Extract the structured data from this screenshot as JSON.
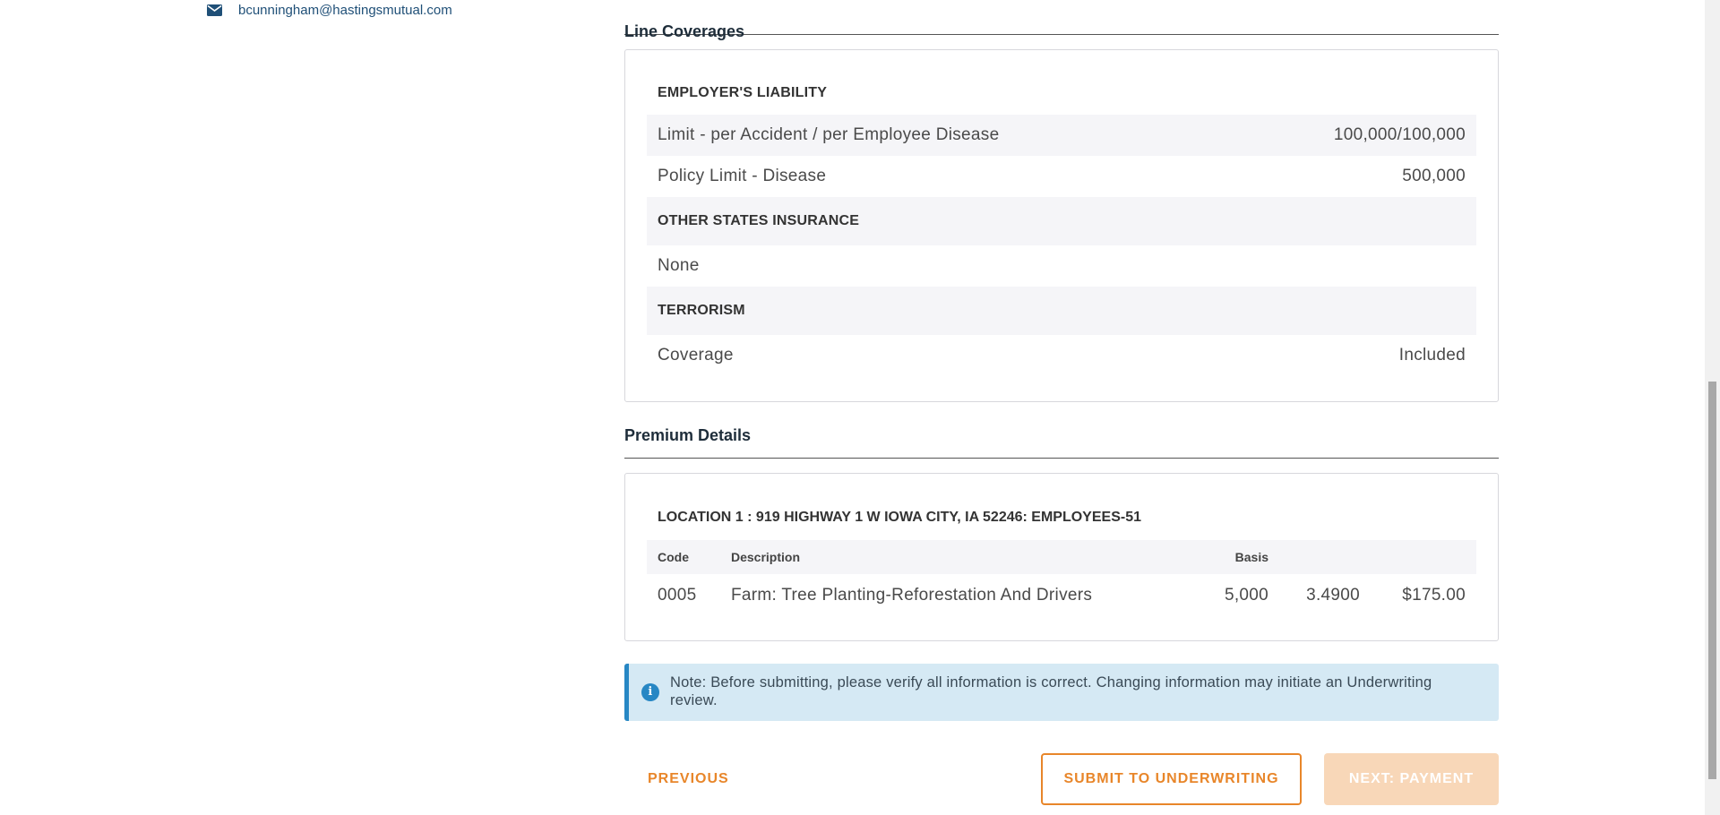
{
  "contact": {
    "email": "bcunningham@hastingsmutual.com",
    "icon": "envelope-icon"
  },
  "line_coverages": {
    "title": "Line Coverages",
    "groups": {
      "employers_liability": {
        "heading": "EMPLOYER'S LIABILITY",
        "rows": [
          {
            "label": "Limit - per Accident / per Employee Disease",
            "value": "100,000/100,000"
          },
          {
            "label": "Policy Limit - Disease",
            "value": "500,000"
          }
        ]
      },
      "other_states": {
        "heading": "OTHER STATES INSURANCE",
        "value": "None"
      },
      "terrorism": {
        "heading": "TERRORISM",
        "label": "Coverage",
        "value": "Included"
      }
    }
  },
  "premium_details": {
    "title": "Premium Details",
    "location_title": "LOCATION 1 : 919 HIGHWAY 1 W IOWA CITY, IA 52246: EMPLOYEES-51",
    "columns": {
      "code": "Code",
      "description": "Description",
      "basis": "Basis",
      "rate": "",
      "premium": ""
    },
    "rows": [
      {
        "code": "0005",
        "description": "Farm: Tree Planting-Reforestation And Drivers",
        "basis": "5,000",
        "rate": "3.4900",
        "premium": "$175.00"
      }
    ]
  },
  "note": {
    "text": "Note: Before submitting, please verify all information is correct. Changing information may initiate an Underwriting review.",
    "icon": "info-icon"
  },
  "actions": {
    "previous": "PREVIOUS",
    "submit": "SUBMIT TO UNDERWRITING",
    "next": "NEXT: PAYMENT"
  },
  "colors": {
    "accent_orange": "#e8862a",
    "info_blue": "#2787c4",
    "link_blue": "#1f4f77"
  }
}
